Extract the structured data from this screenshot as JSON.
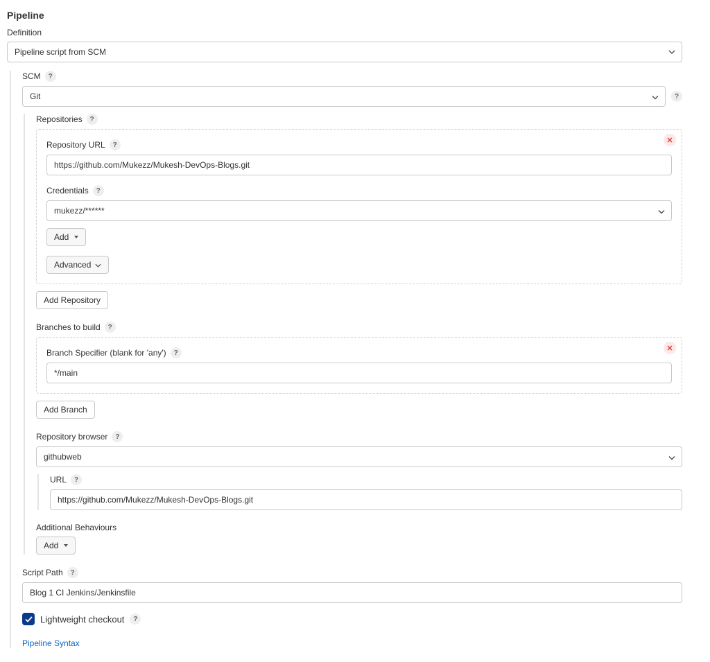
{
  "page_title": "Pipeline",
  "definition": {
    "label": "Definition",
    "value": "Pipeline script from SCM"
  },
  "scm": {
    "label": "SCM",
    "value": "Git"
  },
  "repositories": {
    "label": "Repositories",
    "repo_url": {
      "label": "Repository URL",
      "value": "https://github.com/Mukezz/Mukesh-DevOps-Blogs.git"
    },
    "credentials": {
      "label": "Credentials",
      "value": "mukezz/******"
    },
    "add_btn": "Add",
    "advanced_btn": "Advanced",
    "add_repo_btn": "Add Repository"
  },
  "branches": {
    "label": "Branches to build",
    "specifier": {
      "label": "Branch Specifier (blank for 'any')",
      "value": "*/main"
    },
    "add_branch_btn": "Add Branch"
  },
  "repo_browser": {
    "label": "Repository browser",
    "value": "githubweb",
    "url": {
      "label": "URL",
      "value": "https://github.com/Mukezz/Mukesh-DevOps-Blogs.git"
    }
  },
  "additional": {
    "label": "Additional Behaviours",
    "add_btn": "Add"
  },
  "script_path": {
    "label": "Script Path",
    "value": "Blog 1 CI Jenkins/Jenkinsfile"
  },
  "lightweight": {
    "label": "Lightweight checkout",
    "checked": true
  },
  "syntax_link": "Pipeline Syntax",
  "help_tooltip": "?"
}
